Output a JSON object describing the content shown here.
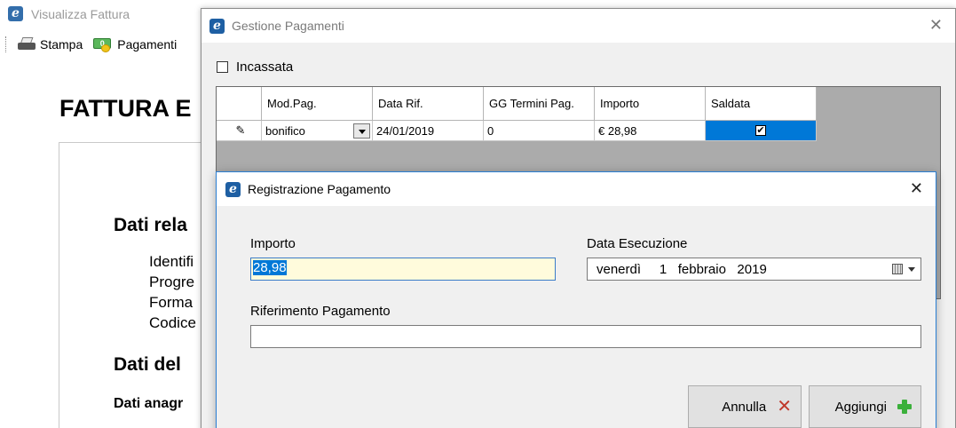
{
  "background_window": {
    "title": "Visualizza Fattura",
    "toolbar": {
      "print_label": "Stampa",
      "payments_label": "Pagamenti"
    },
    "document": {
      "title": "FATTURA E",
      "section1": "Dati rela",
      "lines": [
        "Identifi",
        "Progre",
        "Forma",
        "Codice"
      ],
      "section2": "Dati del",
      "section3": "Dati anagr"
    }
  },
  "gestione_pagamenti": {
    "title": "Gestione Pagamenti",
    "close": "✕",
    "incassata_label": "Incassata",
    "grid": {
      "columns": [
        "Mod.Pag.",
        "Data Rif.",
        "GG Termini Pag.",
        "Importo",
        "Saldata"
      ],
      "rows": [
        {
          "mod_pag": "bonifico",
          "data_rif": "24/01/2019",
          "gg_termini": "0",
          "importo": "€ 28,98",
          "saldata": "✔"
        }
      ]
    }
  },
  "registrazione_pagamento": {
    "title": "Registrazione Pagamento",
    "close": "✕",
    "importo_label": "Importo",
    "importo_value": "28,98",
    "data_esecuzione_label": "Data Esecuzione",
    "data_esecuzione_value": "venerdì     1   febbraio   2019",
    "riferimento_label": "Riferimento Pagamento",
    "riferimento_value": "",
    "annulla_label": "Annulla",
    "aggiungi_label": "Aggiungi"
  },
  "colors": {
    "selection": "#0078d7",
    "input_highlight": "#fffbdc",
    "accent_border": "#2a7fd4"
  }
}
